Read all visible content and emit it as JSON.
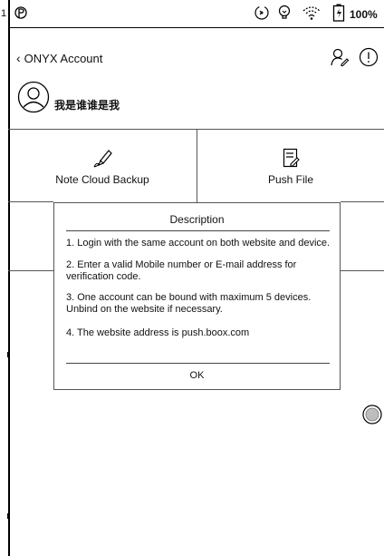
{
  "status_bar": {
    "left_number": "1",
    "battery_text": "100%",
    "icons": [
      "p-icon",
      "sync-icon",
      "lightbulb-icon",
      "wifi-icon",
      "battery-icon"
    ]
  },
  "header": {
    "back_label": "ONYX Account",
    "icons": [
      "account-switch-icon",
      "info-icon"
    ]
  },
  "profile": {
    "username": "我是谁谁是我"
  },
  "tiles": [
    {
      "label": "Note Cloud Backup",
      "icon": "pen-cloud-icon"
    },
    {
      "label": "Push File",
      "icon": "file-edit-icon"
    }
  ],
  "dialog": {
    "title": "Description",
    "items": [
      "1. Login with the same account on both website and device.",
      "2. Enter a valid Mobile number or E-mail address for verification code.",
      "3. One account can be bound with maximum 5 devices. Unbind on the website if necessary.",
      "4. The website address is push.boox.com"
    ],
    "ok_label": "OK"
  }
}
